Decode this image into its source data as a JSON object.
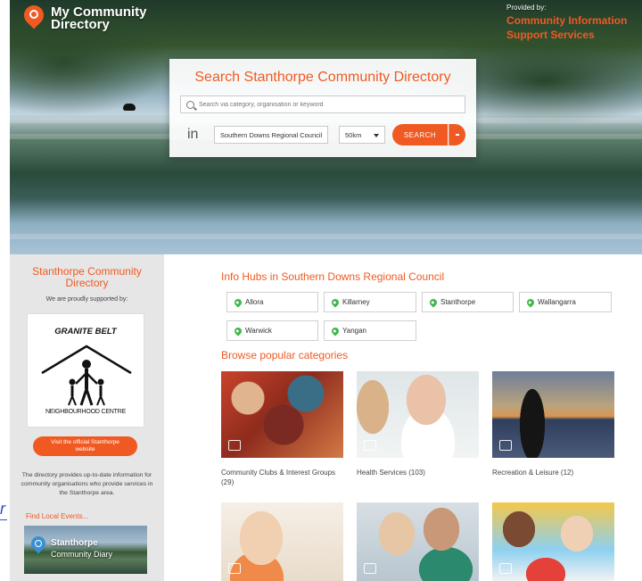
{
  "brand": {
    "line1": "My Community",
    "line2": "Directory"
  },
  "provider": {
    "label": "Provided by:",
    "line1": "Community Information",
    "line2": "Support Services"
  },
  "search": {
    "title": "Search Stanthorpe Community Directory",
    "placeholder": "Search via category, organisation or keyword",
    "in_label": "in",
    "region": "Southern Downs Regional Council",
    "radius": "50km",
    "button": "SEARCH"
  },
  "sidebar": {
    "title_line1": "Stanthorpe Community",
    "title_line2": "Directory",
    "supported_by": "We are proudly supported by:",
    "logo_name": "GRANITE BELT",
    "logo_sub": "NEIGHBOURHOOD CENTRE",
    "visit_line1": "Visit the official Stanthorpe",
    "visit_line2": "website",
    "description": "The directory provides up-to-date information for community organisations who provide services in the Stanthorpe area.",
    "events": "Find Local Events...",
    "diary_line1": "Stanthorpe",
    "diary_line2": "Community Diary"
  },
  "edge_link": "r",
  "hubs": {
    "title": "Info Hubs in Southern Downs Regional Council",
    "items": [
      "Allora",
      "Killarney",
      "Stanthorpe",
      "Wallangarra",
      "Warwick",
      "Yangan"
    ]
  },
  "categories": {
    "title": "Browse popular categories",
    "items": [
      {
        "label": "Community Clubs & Interest Groups (29)"
      },
      {
        "label": "Health Services (103)"
      },
      {
        "label": "Recreation & Leisure (12)"
      }
    ]
  },
  "colors": {
    "accent": "#f05a22",
    "hub_pin": "#3fb84a",
    "sidebar_bg": "#e6e6e6"
  },
  "icons": [
    "map-pin-icon",
    "search-icon",
    "chevron-down-icon",
    "category-badge-icon"
  ]
}
